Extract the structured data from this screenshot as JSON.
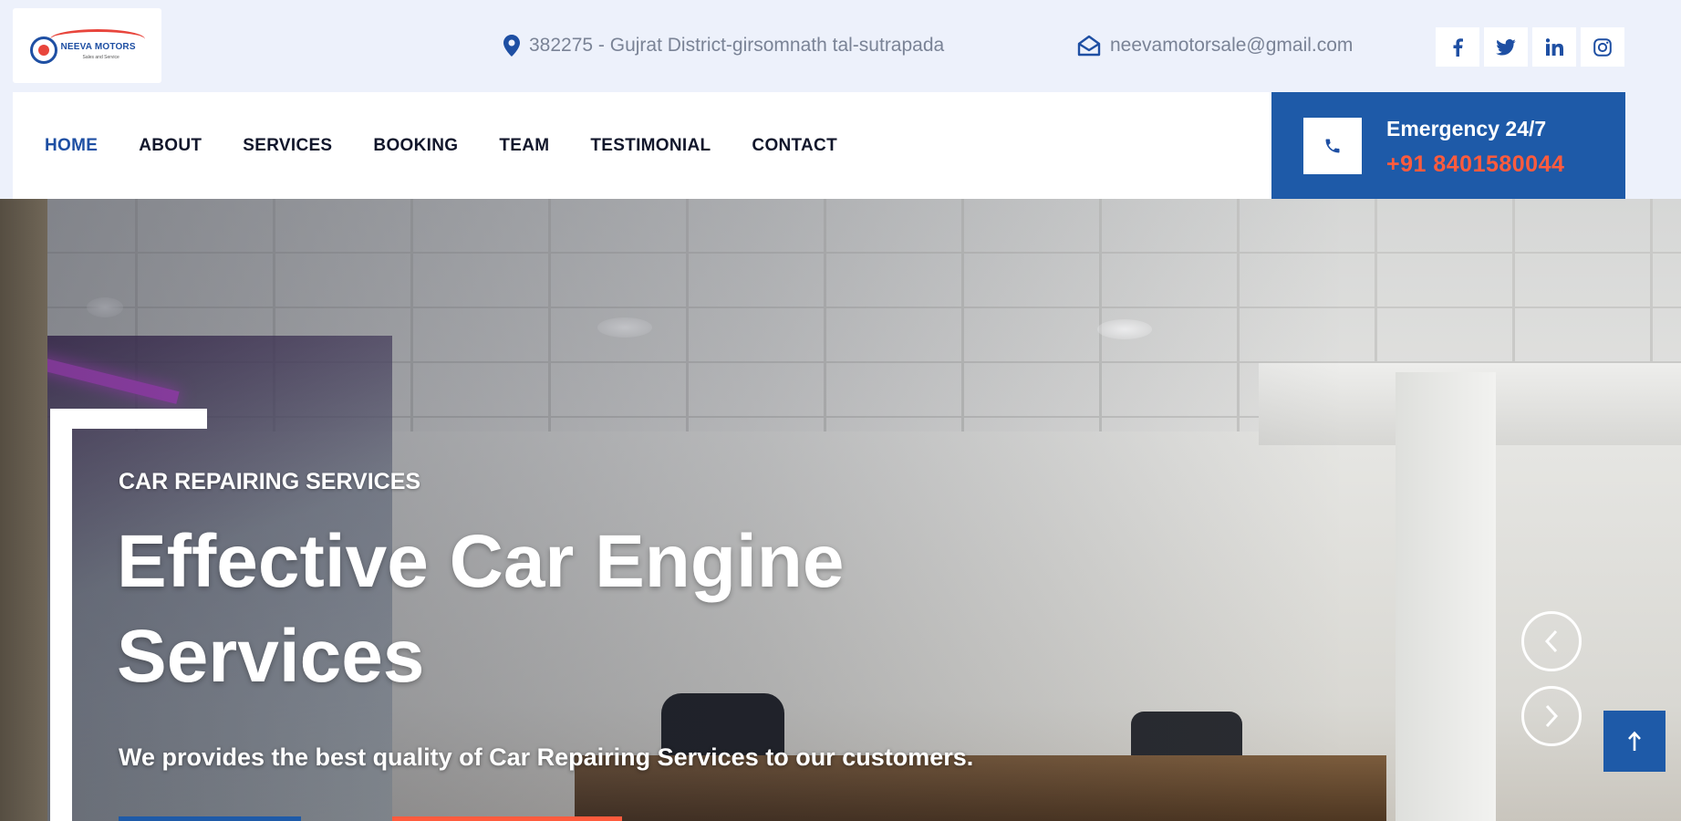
{
  "brand": {
    "logo_word": "NEEVA MOTORS",
    "logo_sub": "Sales and Service"
  },
  "topbar": {
    "address": "382275 - Gujrat District-girsomnath tal-sutrapada",
    "email": "neevamotorsale@gmail.com",
    "socials": [
      {
        "icon": "facebook-icon"
      },
      {
        "icon": "twitter-icon"
      },
      {
        "icon": "linkedin-icon"
      },
      {
        "icon": "instagram-icon"
      }
    ]
  },
  "nav": {
    "items": [
      {
        "label": "HOME",
        "active": true
      },
      {
        "label": "ABOUT"
      },
      {
        "label": "SERVICES"
      },
      {
        "label": "BOOKING"
      },
      {
        "label": "TEAM"
      },
      {
        "label": "TESTIMONIAL"
      },
      {
        "label": "CONTACT"
      }
    ]
  },
  "emergency": {
    "title": "Emergency 24/7",
    "phone": "+91 8401580044"
  },
  "hero": {
    "eyebrow": "CAR REPAIRING SERVICES",
    "title": "Effective Car Engine Services",
    "subtitle": "We provides the best quality of Car Repairing Services to our customers."
  },
  "colors": {
    "primary": "#1e5aa8",
    "accent": "#ff5b3d",
    "topbar_bg": "#edf1fb",
    "nav_active": "#1e4fa3"
  }
}
